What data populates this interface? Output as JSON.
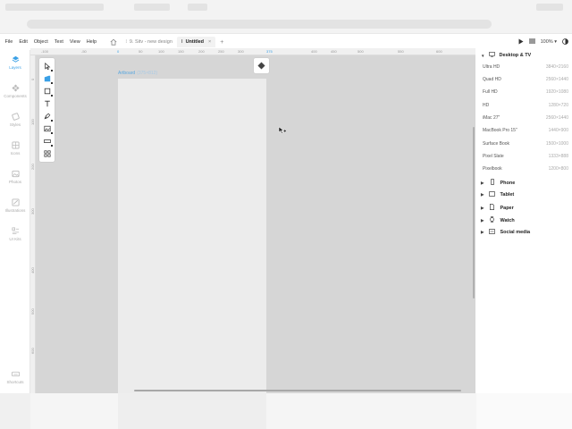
{
  "menubar": {
    "menus": [
      "File",
      "Edit",
      "Object",
      "Text",
      "View",
      "Help"
    ],
    "tabs": [
      {
        "label": "9. Sitv - new design",
        "active": false
      },
      {
        "label": "Untitled",
        "active": true
      }
    ],
    "tab_close": "×",
    "new_tab": "+",
    "zoom": "100%",
    "zoom_caret": "▾"
  },
  "rail": {
    "items": [
      {
        "label": "Layers",
        "icon": "layers-icon",
        "active": true
      },
      {
        "label": "Components",
        "icon": "components-icon",
        "active": false
      },
      {
        "label": "Styles",
        "icon": "styles-icon",
        "active": false
      },
      {
        "label": "Icons",
        "icon": "icons-icon",
        "active": false
      },
      {
        "label": "Photos",
        "icon": "photos-icon",
        "active": false
      },
      {
        "label": "Illustrations",
        "icon": "illustrations-icon",
        "active": false
      },
      {
        "label": "UI Kits",
        "icon": "ui-kits-icon",
        "active": false
      }
    ],
    "shortcuts": "Shortcuts"
  },
  "ruler": {
    "ticks": [
      "-100",
      "-50",
      "0",
      "50",
      "100",
      "150",
      "200",
      "250",
      "300",
      "375",
      "400",
      "450",
      "500",
      "550",
      "600"
    ],
    "vticks": [
      "0",
      "100",
      "200",
      "300",
      "400",
      "500",
      "600"
    ]
  },
  "canvas": {
    "artboard_name": "Artboard",
    "artboard_dims": "(375×812)"
  },
  "right_panel": {
    "section": "Desktop & TV",
    "presets": [
      {
        "name": "Ultra HD",
        "size": "3840×2160"
      },
      {
        "name": "Quad HD",
        "size": "2560×1440"
      },
      {
        "name": "Full HD",
        "size": "1920×1080"
      },
      {
        "name": "HD",
        "size": "1280×720"
      },
      {
        "name": "iMac 27\"",
        "size": "2560×1440"
      },
      {
        "name": "MacBook Pro 15\"",
        "size": "1440×900"
      },
      {
        "name": "Surface Book",
        "size": "1500×1000"
      },
      {
        "name": "Pixel Slate",
        "size": "1333×888"
      },
      {
        "name": "Pixelbook",
        "size": "1200×800"
      }
    ],
    "categories": [
      {
        "name": "Phone",
        "icon": "phone-icon"
      },
      {
        "name": "Tablet",
        "icon": "tablet-icon"
      },
      {
        "name": "Paper",
        "icon": "paper-icon"
      },
      {
        "name": "Watch",
        "icon": "watch-icon"
      },
      {
        "name": "Social media",
        "icon": "social-media-icon"
      }
    ]
  },
  "colors": {
    "accent": "#3aa0e6",
    "canvas": "#d6d6d6",
    "artboard": "#ececec"
  }
}
